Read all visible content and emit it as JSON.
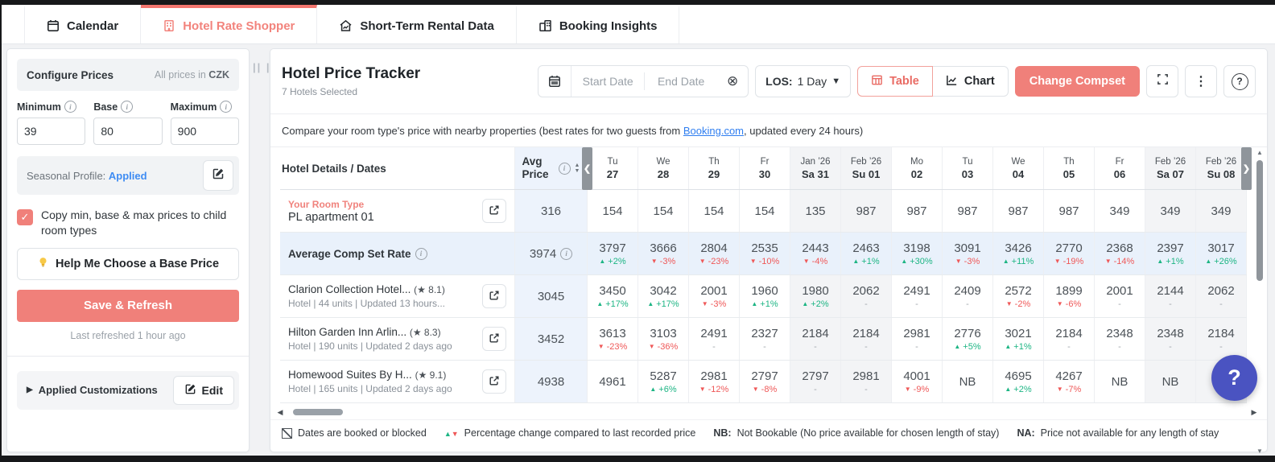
{
  "tabs": [
    {
      "label": "Calendar",
      "icon": "calendar-icon",
      "active": false
    },
    {
      "label": "Hotel Rate Shopper",
      "icon": "hotel-icon",
      "active": true
    },
    {
      "label": "Short-Term Rental Data",
      "icon": "rental-icon",
      "active": false
    },
    {
      "label": "Booking Insights",
      "icon": "insights-icon",
      "active": false
    }
  ],
  "sidebar": {
    "header": {
      "title": "Configure Prices",
      "currency_prefix": "All prices in ",
      "currency": "CZK"
    },
    "fields": [
      {
        "label": "Minimum",
        "value": "39"
      },
      {
        "label": "Base",
        "value": "80"
      },
      {
        "label": "Maximum",
        "value": "900"
      }
    ],
    "seasonal": {
      "label": "Seasonal Profile: ",
      "status": "Applied"
    },
    "copy_label": "Copy min, base & max prices to child room types",
    "help_button": "Help Me Choose a Base Price",
    "save_button": "Save & Refresh",
    "last_refreshed": "Last refreshed 1 hour ago",
    "customizations": {
      "label": "Applied Customizations",
      "edit": "Edit"
    }
  },
  "main": {
    "title": "Hotel Price Tracker",
    "subtitle": "7 Hotels Selected",
    "date_picker": {
      "start": "Start Date",
      "end": "End Date"
    },
    "los": {
      "label": "LOS:",
      "value": "1 Day"
    },
    "view_toggle": {
      "table": "Table",
      "chart": "Chart",
      "active": "Table"
    },
    "change_compset": "Change Compset",
    "description": {
      "before": "Compare your room type's price with nearby properties (best rates for two guests from ",
      "link": "Booking.com",
      "after": ", updated every 24 hours)"
    }
  },
  "table": {
    "name_header": "Hotel Details / Dates",
    "avg_header": "Avg Price",
    "columns": [
      {
        "month": "",
        "day": "Tu",
        "date": "27",
        "weekend": false
      },
      {
        "month": "",
        "day": "We",
        "date": "28",
        "weekend": false
      },
      {
        "month": "",
        "day": "Th",
        "date": "29",
        "weekend": false
      },
      {
        "month": "",
        "day": "Fr",
        "date": "30",
        "weekend": false
      },
      {
        "month": "Jan ’26",
        "day": "Sa",
        "date": "31",
        "weekend": true
      },
      {
        "month": "Feb ’26",
        "day": "Su",
        "date": "01",
        "weekend": true
      },
      {
        "month": "",
        "day": "Mo",
        "date": "02",
        "weekend": false
      },
      {
        "month": "",
        "day": "Tu",
        "date": "03",
        "weekend": false
      },
      {
        "month": "",
        "day": "We",
        "date": "04",
        "weekend": false
      },
      {
        "month": "",
        "day": "Th",
        "date": "05",
        "weekend": false
      },
      {
        "month": "",
        "day": "Fr",
        "date": "06",
        "weekend": false
      },
      {
        "month": "Feb ’26",
        "day": "Sa",
        "date": "07",
        "weekend": true
      },
      {
        "month": "Feb ’26",
        "day": "Su",
        "date": "08",
        "weekend": true
      }
    ],
    "rows": [
      {
        "type": "your-room",
        "label": "Your Room Type",
        "name": "PL apartment 01",
        "avg": "316",
        "cells": [
          {
            "v": "154"
          },
          {
            "v": "154"
          },
          {
            "v": "154"
          },
          {
            "v": "154"
          },
          {
            "v": "135"
          },
          {
            "v": "987"
          },
          {
            "v": "987"
          },
          {
            "v": "987"
          },
          {
            "v": "987"
          },
          {
            "v": "987"
          },
          {
            "v": "349"
          },
          {
            "v": "349"
          },
          {
            "v": "349"
          }
        ]
      },
      {
        "type": "compset",
        "name": "Average Comp Set Rate",
        "avg": "3974",
        "cells": [
          {
            "v": "3797",
            "pct": "+2%",
            "dir": "up"
          },
          {
            "v": "3666",
            "pct": "-3%",
            "dir": "down"
          },
          {
            "v": "2804",
            "pct": "-23%",
            "dir": "down"
          },
          {
            "v": "2535",
            "pct": "-10%",
            "dir": "down"
          },
          {
            "v": "2443",
            "pct": "-4%",
            "dir": "down"
          },
          {
            "v": "2463",
            "pct": "+1%",
            "dir": "up"
          },
          {
            "v": "3198",
            "pct": "+30%",
            "dir": "up"
          },
          {
            "v": "3091",
            "pct": "-3%",
            "dir": "down"
          },
          {
            "v": "3426",
            "pct": "+11%",
            "dir": "up"
          },
          {
            "v": "2770",
            "pct": "-19%",
            "dir": "down"
          },
          {
            "v": "2368",
            "pct": "-14%",
            "dir": "down"
          },
          {
            "v": "2397",
            "pct": "+1%",
            "dir": "up"
          },
          {
            "v": "3017",
            "pct": "+26%",
            "dir": "up"
          }
        ]
      },
      {
        "type": "hotel",
        "name": "Clarion Collection Hotel...",
        "rating": "8.1",
        "meta": "Hotel | 44 units | Updated 13 hours...",
        "avg": "3045",
        "cells": [
          {
            "v": "3450",
            "pct": "+17%",
            "dir": "up"
          },
          {
            "v": "3042",
            "pct": "+17%",
            "dir": "up"
          },
          {
            "v": "2001",
            "pct": "-3%",
            "dir": "down"
          },
          {
            "v": "1960",
            "pct": "+1%",
            "dir": "up"
          },
          {
            "v": "1980",
            "pct": "+2%",
            "dir": "up"
          },
          {
            "v": "2062",
            "pct": "-",
            "dir": "none"
          },
          {
            "v": "2491",
            "pct": "-",
            "dir": "none"
          },
          {
            "v": "2409",
            "pct": "-",
            "dir": "none"
          },
          {
            "v": "2572",
            "pct": "-2%",
            "dir": "down"
          },
          {
            "v": "1899",
            "pct": "-6%",
            "dir": "down"
          },
          {
            "v": "2001",
            "pct": "-",
            "dir": "none"
          },
          {
            "v": "2144",
            "pct": "-",
            "dir": "none"
          },
          {
            "v": "2062",
            "pct": "-",
            "dir": "none"
          }
        ]
      },
      {
        "type": "hotel",
        "name": "Hilton Garden Inn Arlin...",
        "rating": "8.3",
        "meta": "Hotel | 190 units | Updated 2 days ago",
        "avg": "3452",
        "cells": [
          {
            "v": "3613",
            "pct": "-23%",
            "dir": "down"
          },
          {
            "v": "3103",
            "pct": "-36%",
            "dir": "down"
          },
          {
            "v": "2491",
            "pct": "-",
            "dir": "none"
          },
          {
            "v": "2327",
            "pct": "-",
            "dir": "none"
          },
          {
            "v": "2184",
            "pct": "-",
            "dir": "none"
          },
          {
            "v": "2184",
            "pct": "-",
            "dir": "none"
          },
          {
            "v": "2981",
            "pct": "-",
            "dir": "none"
          },
          {
            "v": "2776",
            "pct": "+5%",
            "dir": "up"
          },
          {
            "v": "3021",
            "pct": "+1%",
            "dir": "up"
          },
          {
            "v": "2184",
            "pct": "-",
            "dir": "none"
          },
          {
            "v": "2348",
            "pct": "-",
            "dir": "none"
          },
          {
            "v": "2348",
            "pct": "-",
            "dir": "none"
          },
          {
            "v": "2184",
            "pct": "-",
            "dir": "none"
          }
        ]
      },
      {
        "type": "hotel",
        "name": "Homewood Suites By H...",
        "rating": "9.1",
        "meta": "Hotel | 165 units | Updated 2 days ago",
        "avg": "4938",
        "cells": [
          {
            "v": "4961"
          },
          {
            "v": "5287",
            "pct": "+6%",
            "dir": "up"
          },
          {
            "v": "2981",
            "pct": "-12%",
            "dir": "down"
          },
          {
            "v": "2797",
            "pct": "-8%",
            "dir": "down"
          },
          {
            "v": "2797",
            "pct": "-",
            "dir": "none"
          },
          {
            "v": "2981",
            "pct": "-",
            "dir": "none"
          },
          {
            "v": "4001",
            "pct": "-9%",
            "dir": "down"
          },
          {
            "v": "NB"
          },
          {
            "v": "4695",
            "pct": "+2%",
            "dir": "up"
          },
          {
            "v": "4267",
            "pct": "-7%",
            "dir": "down"
          },
          {
            "v": "NB"
          },
          {
            "v": "NB"
          },
          {
            "v": "4"
          }
        ]
      }
    ],
    "legend": [
      {
        "icon": "booked-square",
        "text": "Dates are booked or blocked"
      },
      {
        "icon": "pct-triangles",
        "text": "Percentage change compared to last recorded price"
      },
      {
        "bold": "NB:",
        "text": "Not Bookable (No price available for chosen length of stay)"
      },
      {
        "bold": "NA:",
        "text": "Price not available for any length of stay"
      }
    ]
  },
  "colors": {
    "accent_salmon": "#f0807a",
    "positive_green": "#1db584",
    "negative_red": "#ef5858",
    "link_blue": "#2f7ef0",
    "help_bubble_blue": "#4a53c1"
  }
}
